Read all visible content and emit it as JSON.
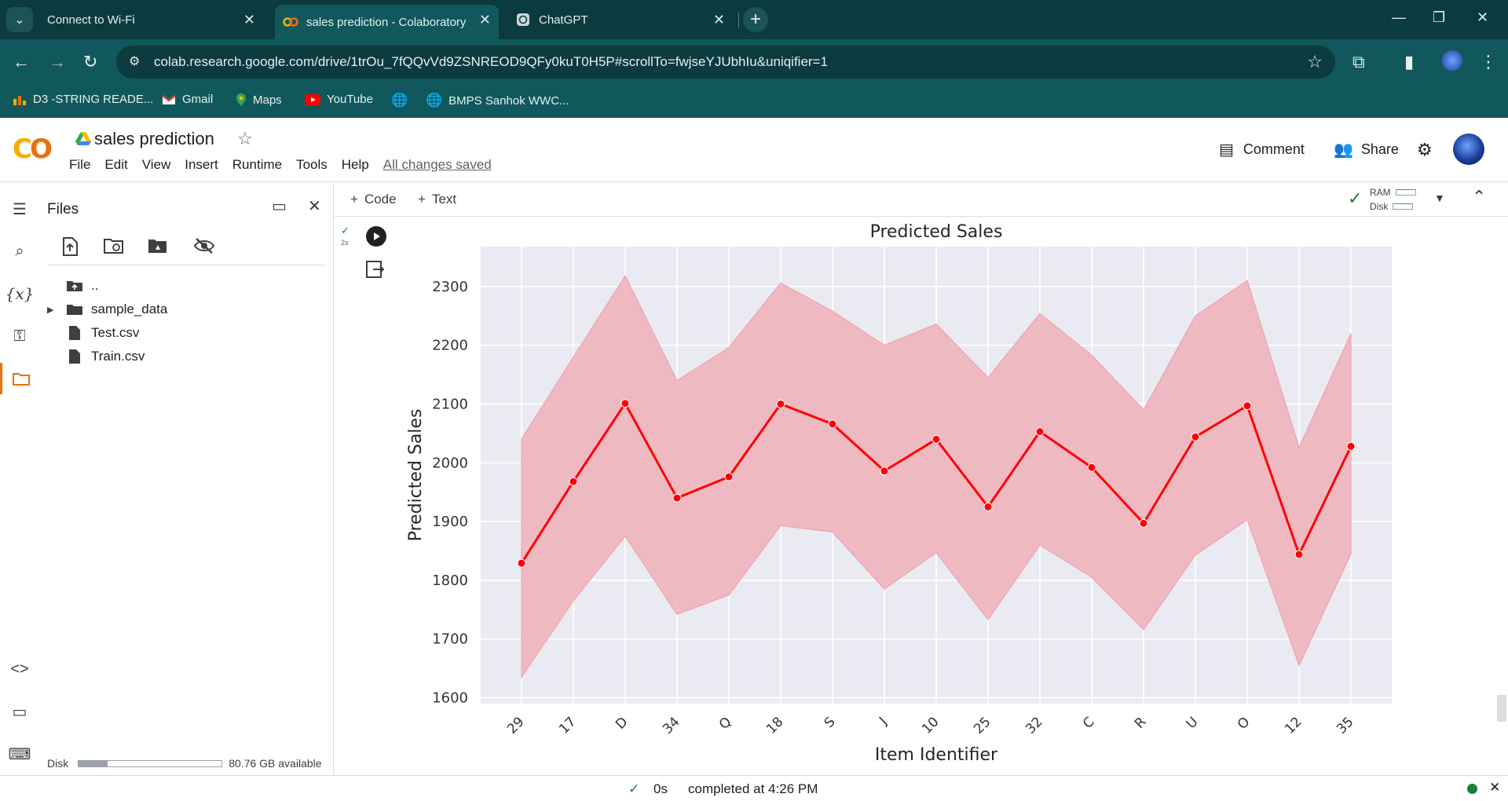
{
  "browser": {
    "tabs": [
      {
        "title": "Connect to Wi-Fi",
        "active": false
      },
      {
        "title": "sales prediction - Colaboratory",
        "active": true
      },
      {
        "title": "ChatGPT",
        "active": false
      }
    ],
    "url": "colab.research.google.com/drive/1trOu_7fQQvVd9ZSNREOD9QFy0kuT0H5P#scrollTo=fwjseYJUbhIu&uniqifier=1",
    "bookmarks": [
      "D3 -STRING READE...",
      "Gmail",
      "Maps",
      "YouTube",
      "",
      "BMPS Sanhok WWC..."
    ]
  },
  "colab": {
    "notebook_title": "sales prediction",
    "menu": [
      "File",
      "Edit",
      "View",
      "Insert",
      "Runtime",
      "Tools",
      "Help"
    ],
    "save_status": "All changes saved",
    "comment_label": "Comment",
    "share_label": "Share",
    "add_code_label": "Code",
    "add_text_label": "Text",
    "ram_label": "RAM",
    "disk_label": "Disk"
  },
  "files_panel": {
    "title": "Files",
    "items": [
      {
        "name": "..",
        "type": "parent"
      },
      {
        "name": "sample_data",
        "type": "folder"
      },
      {
        "name": "Test.csv",
        "type": "file"
      },
      {
        "name": "Train.csv",
        "type": "file"
      }
    ],
    "disk_label": "Disk",
    "disk_available": "80.76 GB available",
    "disk_used_fraction": 0.2
  },
  "cell": {
    "run_time": "2s"
  },
  "status_bar": {
    "duration": "0s",
    "completed": "completed at 4:26 PM"
  },
  "colors": {
    "line": "#ff0000",
    "band": "#f0b4bc",
    "plot_bg": "#eaeaf2",
    "chrome_dark": "#0b3b3e",
    "chrome": "#11585c"
  },
  "chart_data": {
    "type": "line",
    "title": "Predicted Sales",
    "xlabel": "Item Identifier",
    "ylabel": "Predicted Sales",
    "categories": [
      "29",
      "17",
      "D",
      "34",
      "Q",
      "18",
      "S",
      "J",
      "10",
      "25",
      "32",
      "C",
      "R",
      "U",
      "O",
      "12",
      "35"
    ],
    "series": [
      {
        "values": [
          1829,
          1968,
          2101,
          1940,
          1976,
          2100,
          2066,
          1986,
          2040,
          1925,
          2053,
          1992,
          1897,
          2044,
          2097,
          1844,
          2028
        ],
        "ci_upper": [
          2040,
          2180,
          2318,
          2140,
          2196,
          2306,
          2258,
          2200,
          2236,
          2145,
          2254,
          2183,
          2090,
          2250,
          2310,
          2026,
          2220
        ],
        "ci_lower": [
          1635,
          1765,
          1875,
          1742,
          1775,
          1893,
          1882,
          1785,
          1847,
          1733,
          1860,
          1805,
          1716,
          1843,
          1903,
          1655,
          1845
        ]
      }
    ],
    "yticks": [
      1600,
      1700,
      1800,
      1900,
      2000,
      2100,
      2200,
      2300
    ],
    "ylim": [
      1590,
      2368
    ],
    "grid": true
  }
}
